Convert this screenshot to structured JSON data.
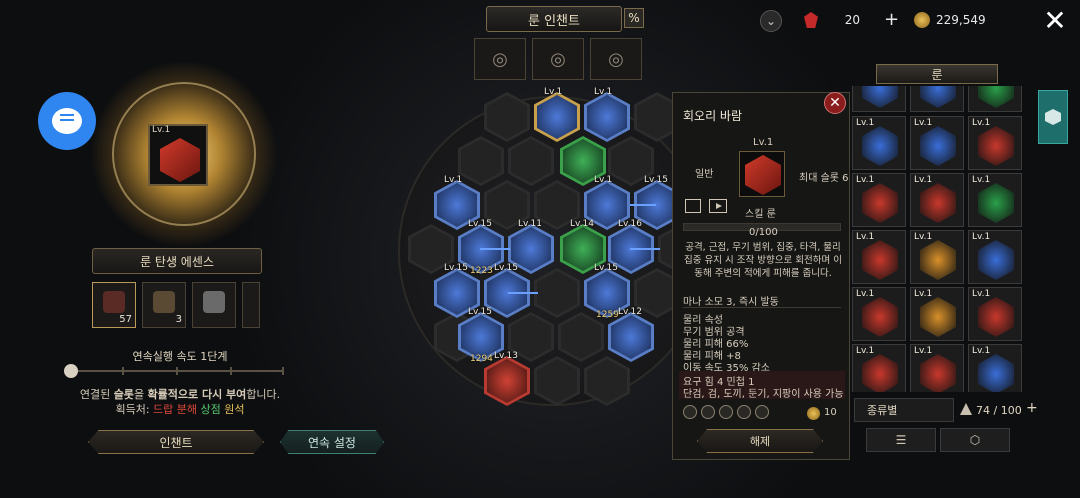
{
  "header": {
    "title": "룬 인챈트",
    "percent_icon": "%",
    "gem_count": "20",
    "plus": "+",
    "gold": "229,549",
    "close": "✕",
    "down_arrow": "⌄"
  },
  "left": {
    "main_rune_level": "Lv.1",
    "essence_label": "룬 탄생 에센스",
    "essence_items": [
      {
        "count": "57"
      },
      {
        "count": "3"
      },
      {
        "count": ""
      },
      {
        "count": ""
      }
    ],
    "speed_label": "연속실행 속도 1단계",
    "desc_line1_a": "연결된 ",
    "desc_line1_b": "슬롯",
    "desc_line1_c": "을 ",
    "desc_line1_d": "확률적으로 다시 부여",
    "desc_line1_e": "합니다.",
    "desc_line2_prefix": "획득처: ",
    "desc_line2_drop": "드랍",
    "desc_line2_decomp": "분해",
    "desc_line2_shop": "상점",
    "desc_line2_craft": "원석",
    "enchant_button": "인챈트",
    "continuous_button": "연속 설정"
  },
  "board": {
    "hexes": [
      {
        "lv": "",
        "type": "empty"
      },
      {
        "lv": "Lv.1",
        "type": "gold"
      },
      {
        "lv": "Lv.1",
        "type": "blue"
      },
      {
        "lv": "",
        "type": "empty"
      },
      {
        "lv": "",
        "type": "green"
      },
      {
        "lv": "Lv.1",
        "type": "blue"
      },
      {
        "lv": "Lv.1",
        "type": "blue"
      },
      {
        "lv": "Lv.15",
        "type": "blue"
      },
      {
        "lv": "Lv.15",
        "type": "blue",
        "count": "1223"
      },
      {
        "lv": "Lv.11",
        "type": "blue"
      },
      {
        "lv": "Lv.14",
        "type": "green"
      },
      {
        "lv": "Lv.16",
        "type": "blue"
      },
      {
        "lv": "Lv.15",
        "type": "blue"
      },
      {
        "lv": "Lv.15",
        "type": "blue"
      },
      {
        "lv": "Lv.15",
        "type": "blue",
        "count": "1259"
      },
      {
        "lv": "Lv.15",
        "type": "blue",
        "count": "1294"
      },
      {
        "lv": "Lv.12",
        "type": "blue"
      },
      {
        "lv": "Lv.13",
        "type": "red"
      }
    ]
  },
  "tooltip": {
    "name": "회오리 바람",
    "level": "Lv.1",
    "grade": "일반",
    "max_slot": "최대 슬롯 6",
    "type": "스킬 룬",
    "progress": "0/100",
    "description": "공격, 근접, 무기 범위, 집중, 타격, 물리 집중 유지 시 조작 방향으로 회전하며 이동해 주변의 적에게 피해를 줍니다.",
    "mana": "마나 소모 3, 즉시 발동",
    "stats": [
      "물리 속성",
      "무기 범위 공격",
      "물리 피해 66%",
      "물리 피해 +8",
      "이동 속도 35% 감소"
    ],
    "req1": "요구 힘 4 민첩 1",
    "req2": "단검, 검, 도끼, 둔기, 지팡이 사용 가능",
    "cost": "10",
    "unequip_button": "해제"
  },
  "inventory": {
    "title": "룬",
    "cells": [
      {
        "lv": "",
        "color": "#3a6ed8"
      },
      {
        "lv": "",
        "color": "#3a6ed8"
      },
      {
        "lv": "",
        "color": "#2aa04a"
      },
      {
        "lv": "Lv.1",
        "color": "#3a6ed8"
      },
      {
        "lv": "Lv.1",
        "color": "#3a6ed8"
      },
      {
        "lv": "Lv.1",
        "color": "#c8382c"
      },
      {
        "lv": "Lv.1",
        "color": "#c8382c"
      },
      {
        "lv": "Lv.1",
        "color": "#c8382c"
      },
      {
        "lv": "Lv.1",
        "color": "#2aa04a"
      },
      {
        "lv": "Lv.1",
        "color": "#c8382c"
      },
      {
        "lv": "Lv.1",
        "color": "#d8902a"
      },
      {
        "lv": "Lv.1",
        "color": "#3a6ed8"
      },
      {
        "lv": "Lv.1",
        "color": "#c8382c"
      },
      {
        "lv": "Lv.1",
        "color": "#d8902a"
      },
      {
        "lv": "Lv.1",
        "color": "#c8382c"
      },
      {
        "lv": "Lv.1",
        "color": "#c8382c"
      },
      {
        "lv": "Lv.1",
        "color": "#c8382c"
      },
      {
        "lv": "Lv.1",
        "color": "#3a6ed8"
      }
    ],
    "sort_label": "종류별",
    "count": "74 / 100",
    "plus": "+",
    "list_icon": "☰",
    "cube_icon": "⬡"
  }
}
